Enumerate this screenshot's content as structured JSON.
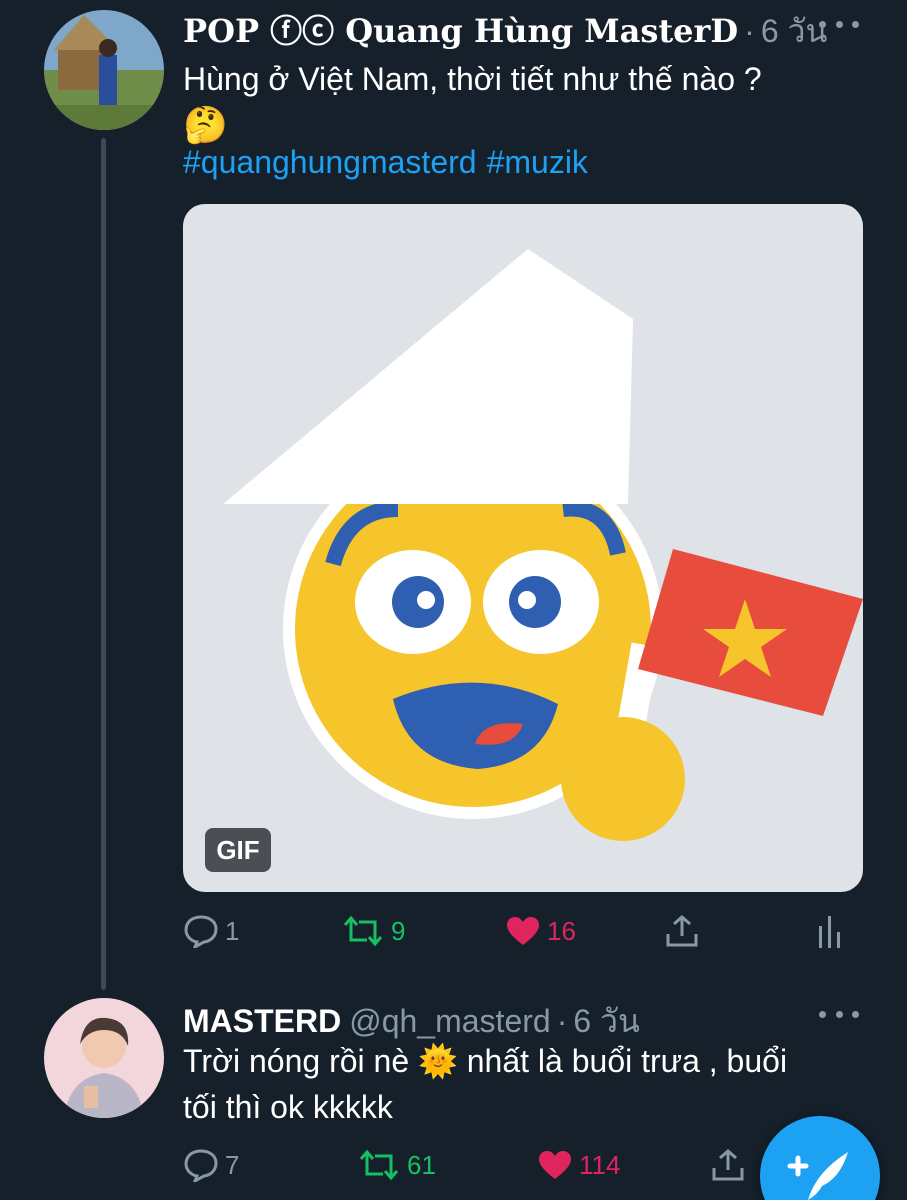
{
  "tweet1": {
    "display_name": "POP ⓕⓒ Quang Hùng MasterD",
    "dot": "·",
    "time": "6 วัน",
    "text_line1": "Hùng ở Việt Nam, thời tiết như thế nào ?",
    "text_emoji": "🤔",
    "hashtags": [
      "#quanghungmasterd",
      "#muzik"
    ],
    "media_badge": "GIF",
    "replies": "1",
    "retweets": "9",
    "likes": "16"
  },
  "tweet2": {
    "display_name": "MASTERD",
    "handle": "@qh_masterd",
    "dot": "·",
    "time": "6 วัน",
    "text_line1": "Trời nóng rồi nè 🌞 nhất là buổi trưa , buổi",
    "text_line2": "tối thì ok kkkkk",
    "replies": "7",
    "retweets": "61",
    "likes": "114"
  },
  "colors": {
    "background": "#15202b",
    "accent": "#1da1f2",
    "muted": "#8899a6",
    "retweet": "#17bf63",
    "like": "#e0245e"
  },
  "icons": [
    "more-icon",
    "reply-icon",
    "retweet-icon",
    "heart-icon",
    "share-icon",
    "analytics-icon",
    "compose-tweet-icon"
  ]
}
